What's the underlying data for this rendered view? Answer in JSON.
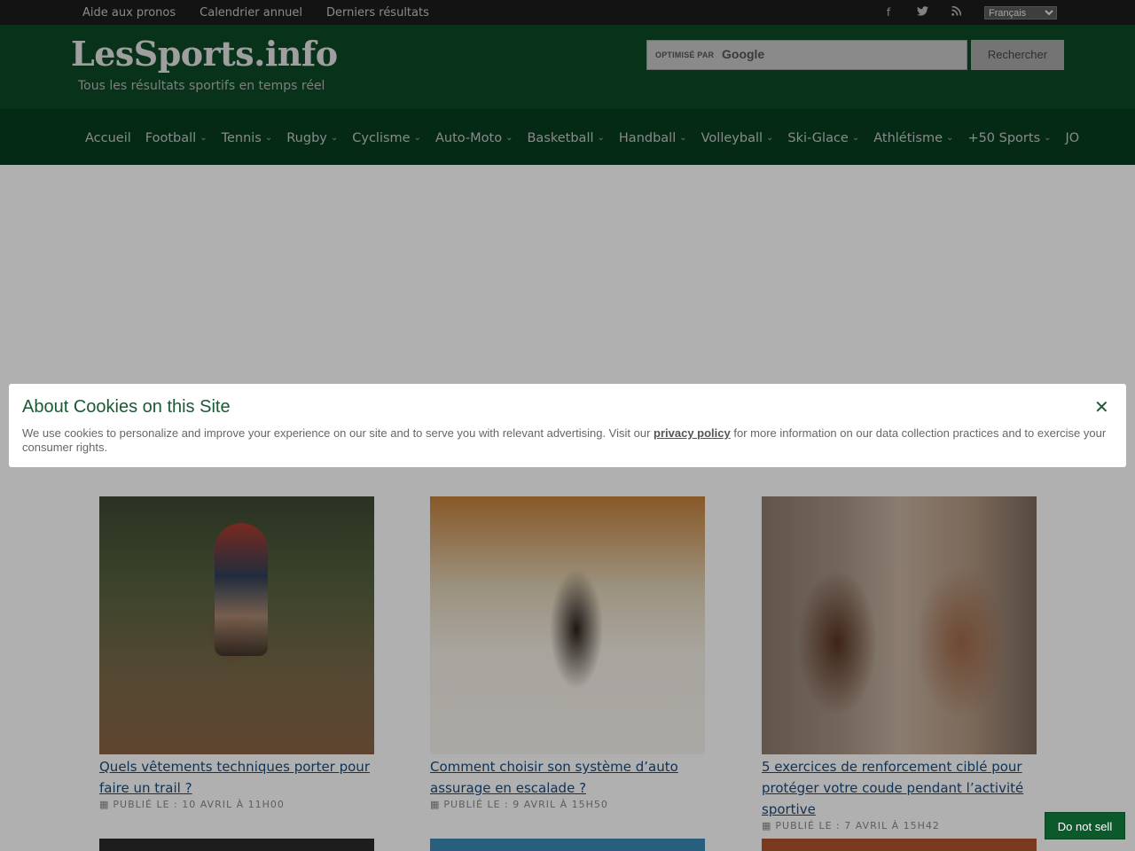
{
  "topbar": {
    "links": [
      "Aide aux pronos",
      "Calendrier annuel",
      "Derniers résultats"
    ],
    "social_icons": [
      "facebook-icon",
      "twitter-icon",
      "rss-icon"
    ],
    "social_glyphs": [
      "f",
      "🐦",
      "◠"
    ],
    "language_selected": "Français"
  },
  "header": {
    "logo": "LesSports.info",
    "tagline": "Tous les résultats sportifs en temps réel",
    "search_label": "OPTIMISÉ PAR",
    "search_brand": "Google",
    "search_button": "Rechercher"
  },
  "nav": {
    "items": [
      {
        "label": "Accueil",
        "dropdown": false
      },
      {
        "label": "Football",
        "dropdown": true
      },
      {
        "label": "Tennis",
        "dropdown": true
      },
      {
        "label": "Rugby",
        "dropdown": true
      },
      {
        "label": "Cyclisme",
        "dropdown": true
      },
      {
        "label": "Auto-Moto",
        "dropdown": true
      },
      {
        "label": "Basketball",
        "dropdown": true
      },
      {
        "label": "Handball",
        "dropdown": true
      },
      {
        "label": "Volleyball",
        "dropdown": true
      },
      {
        "label": "Ski-Glace",
        "dropdown": true
      },
      {
        "label": "Athlétisme",
        "dropdown": true
      },
      {
        "label": "+50 Sports",
        "dropdown": true
      },
      {
        "label": "JO",
        "dropdown": false
      }
    ]
  },
  "cookie": {
    "title": "About Cookies on this Site",
    "text_before": "We use cookies to personalize and improve your experience on our site and to serve you with relevant advertising. Visit our ",
    "link": "privacy policy",
    "text_after": " for more information on our data collection practices and to exercise your consumer rights.",
    "close": "✕"
  },
  "articles": [
    {
      "title": "Quels vêtements techniques porter pour faire un trail ?",
      "meta": "Publié le : 10 avril à 11h00"
    },
    {
      "title": "Comment choisir son système d’auto assurage en escalade ?",
      "meta": "Publié le : 9 avril à 15h50"
    },
    {
      "title": "5 exercices de renforcement ciblé pour protéger votre coude pendant l’activité sportive",
      "meta": "Publié le : 7 avril à 15h42"
    }
  ],
  "do_not_sell": "Do not sell",
  "colors": {
    "header_green": "#0d4a27",
    "nav_green": "#073e21",
    "accent_green": "#1a5a34"
  }
}
